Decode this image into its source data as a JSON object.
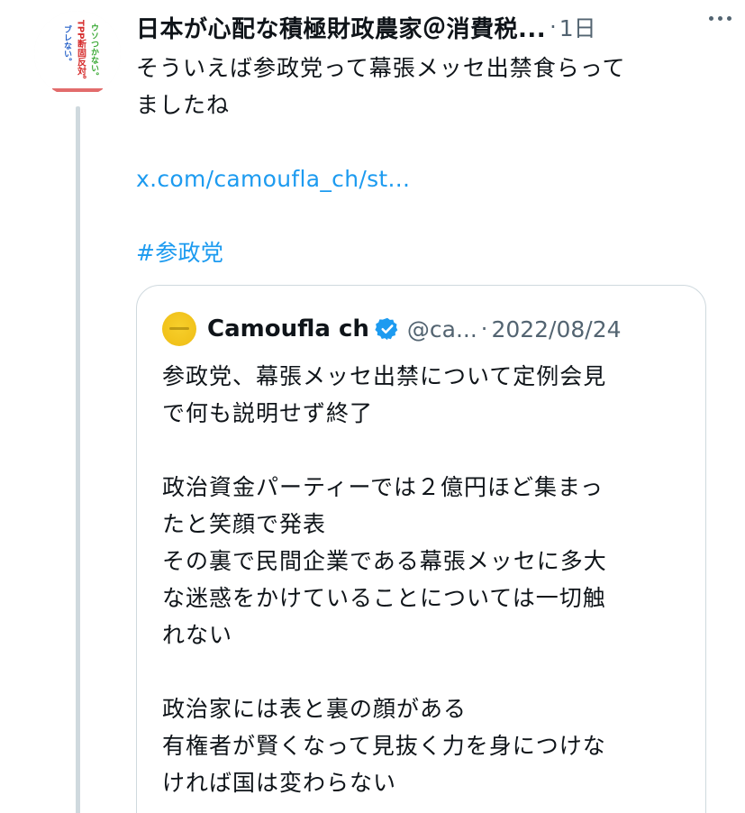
{
  "tweet": {
    "display_name": "日本が心配な積極財政農家＠消費税...",
    "separator": "·",
    "timestamp": "1日",
    "more_icon": "more-horizontal-icon",
    "avatar_text": [
      "ウソつかない。",
      "TPP断固反対。",
      "ブレない。"
    ],
    "text_lines": [
      "そういえば参政党って幕張メッセ出禁食らって",
      "ましたね"
    ],
    "link": "x.com/camoufla_ch/st...",
    "hashtag": "#参政党"
  },
  "quote": {
    "name": "Camoufla ch",
    "verified_icon": "verified-badge-icon",
    "handle": "@ca...",
    "separator": "·",
    "date": "2022/08/24",
    "paragraphs": [
      [
        "参政党、幕張メッセ出禁について定例会見",
        "で何も説明せず終了"
      ],
      [
        "政治資金パーティーでは２億円ほど集まっ",
        "たと笑顔で発表",
        "その裏で民間企業である幕張メッセに多大",
        "な迷惑をかけていることについては一切触",
        "れない"
      ],
      [
        "政治家には表と裏の顔がある",
        "有権者が賢くなって見抜く力を身につけな",
        "ければ国は変わらない"
      ]
    ]
  },
  "colors": {
    "link": "#1d9bf0",
    "verified": "#1d9bf0",
    "text": "#0f1419",
    "secondary": "#536471",
    "border": "#cfd9de"
  }
}
